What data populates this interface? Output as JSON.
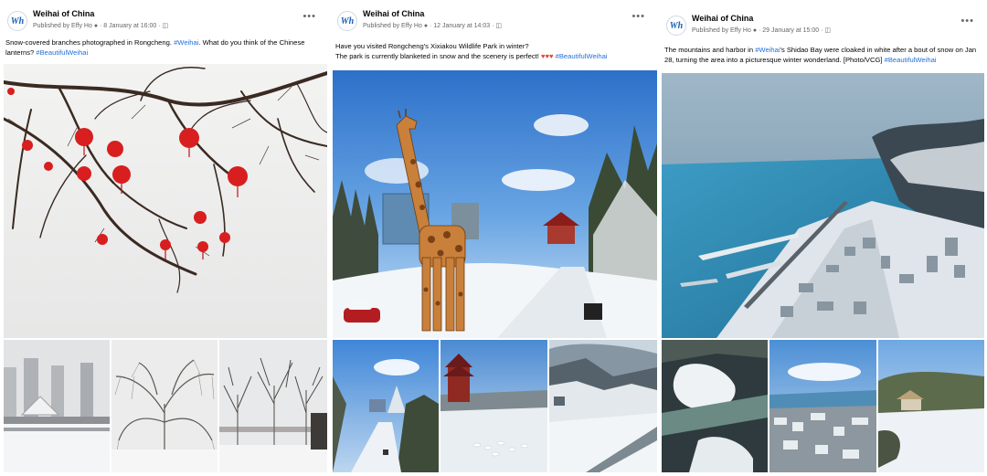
{
  "posts": [
    {
      "page_name": "Weihai of China",
      "publisher": "Published by Effy Ho",
      "date": "8 January at 16:00",
      "caption_text": "Snow-covered branches photographed in Rongcheng. ",
      "caption_tag1": "#Weihai",
      "caption_text2": ". What do you think of the Chinese lanterns? ",
      "caption_tag2": "#BeautifulWeihai",
      "more_icon": "more-options-icon"
    },
    {
      "page_name": "Weihai of China",
      "publisher": "Published by Effy Ho",
      "date": "12 January at 14:03",
      "caption_line1": "Have you visited Rongcheng's Xixiakou Wildlife Park in winter?",
      "caption_line2": "The park is currently blanketed in snow and the scenery is perfect! ",
      "caption_tag": "#BeautifulWeihai",
      "more_icon": "more-options-icon"
    },
    {
      "page_name": "Weihai of China",
      "publisher": "Published by Effy Ho",
      "date": "29 January at 15:00",
      "caption_text": "The mountains and harbor in ",
      "caption_tag1": "#Weihai",
      "caption_text2": "'s Shidao Bay were cloaked in white after a bout of snow on Jan 28, turning the area into a picturesque winter wonderland. [Photo/VCG] ",
      "caption_tag2": "#BeautifulWeihai",
      "more_icon": "more-options-icon"
    }
  ],
  "logo_text": "Wh",
  "colors": {
    "link": "#216fdb",
    "lantern": "#d81e1e",
    "sky": "#3f86d8"
  }
}
